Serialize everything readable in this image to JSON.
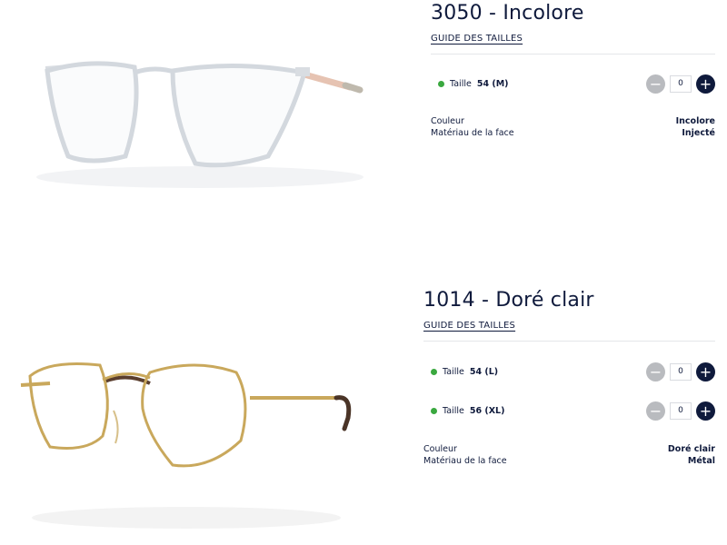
{
  "products": [
    {
      "title": "3050 - Incolore",
      "size_guide": "GUIDE DES TAILLES",
      "sizes": [
        {
          "label": "Taille",
          "value": "54 (M)",
          "quantity": "0"
        }
      ],
      "specs": [
        {
          "key": "Couleur",
          "value": "Incolore"
        },
        {
          "key": "Matériau de la face",
          "value": "Injecté"
        }
      ],
      "frame_color": "#d6dbe0",
      "temple_color": "#e6c3b2"
    },
    {
      "title": "1014 - Doré clair",
      "size_guide": "GUIDE DES TAILLES",
      "sizes": [
        {
          "label": "Taille",
          "value": "54 (L)",
          "quantity": "0"
        },
        {
          "label": "Taille",
          "value": "56 (XL)",
          "quantity": "0"
        }
      ],
      "specs": [
        {
          "key": "Couleur",
          "value": "Doré clair"
        },
        {
          "key": "Matériau de la face",
          "value": "Métal"
        }
      ],
      "frame_color": "#c9a85c",
      "temple_tip_color": "#4a3427"
    }
  ],
  "icons": {
    "minus": "minus-icon",
    "plus": "plus-icon",
    "status": "availability-dot"
  },
  "colors": {
    "available": "#3aa83f",
    "navy": "#0f1a3c",
    "disabled": "#b9bbbf"
  }
}
